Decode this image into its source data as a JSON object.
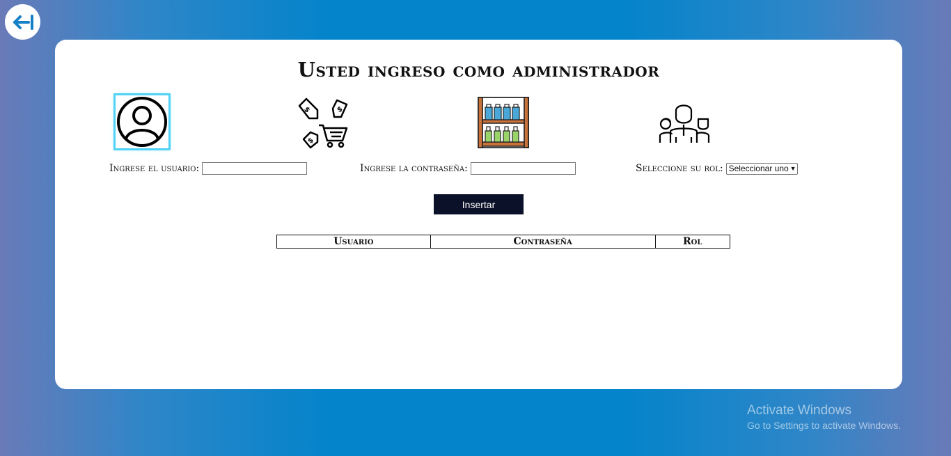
{
  "header": {
    "back_label": ""
  },
  "title": "Usted ingreso como administrador",
  "form": {
    "user_label": "Ingrese el usuario:",
    "user_value": "",
    "password_label": "Ingrese la contraseña:",
    "password_value": "",
    "role_label": "Seleccione su rol:",
    "role_selected": "Seleccionar uno",
    "insert_button": "Insertar"
  },
  "table": {
    "columns": [
      "Usuario",
      "Contraseña",
      "Rol"
    ]
  },
  "icons": [
    "user-icon",
    "sales-tags-cart-icon",
    "store-shelf-icon",
    "team-icon"
  ],
  "watermark": {
    "line1": "Activate Windows",
    "line2": "Go to Settings to activate Windows."
  },
  "colors": {
    "accent": "#0384cb",
    "button": "#0b1128",
    "highlight": "#4fd2f3"
  }
}
